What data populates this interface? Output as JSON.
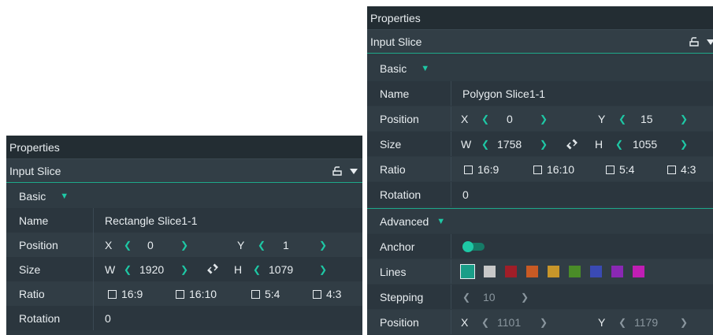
{
  "left_panel": {
    "title": "Properties",
    "subtitle": "Input Slice",
    "basic": {
      "label": "Basic"
    },
    "name": {
      "label": "Name",
      "value": "Rectangle Slice1-1"
    },
    "position": {
      "label": "Position",
      "x_label": "X",
      "x": "0",
      "y_label": "Y",
      "y": "1"
    },
    "size": {
      "label": "Size",
      "w_label": "W",
      "w": "1920",
      "h_label": "H",
      "h": "1079"
    },
    "ratio": {
      "label": "Ratio",
      "options": [
        "16:9",
        "16:10",
        "5:4",
        "4:3"
      ]
    },
    "rotation": {
      "label": "Rotation",
      "value": "0"
    }
  },
  "right_panel": {
    "title": "Properties",
    "subtitle": "Input Slice",
    "basic": {
      "label": "Basic"
    },
    "name": {
      "label": "Name",
      "value": "Polygon Slice1-1"
    },
    "position": {
      "label": "Position",
      "x_label": "X",
      "x": "0",
      "y_label": "Y",
      "y": "15"
    },
    "size": {
      "label": "Size",
      "w_label": "W",
      "w": "1758",
      "h_label": "H",
      "h": "1055"
    },
    "ratio": {
      "label": "Ratio",
      "options": [
        "16:9",
        "16:10",
        "5:4",
        "4:3"
      ]
    },
    "rotation": {
      "label": "Rotation",
      "value": "0"
    },
    "advanced": {
      "label": "Advanced"
    },
    "anchor": {
      "label": "Anchor",
      "enabled": true
    },
    "lines": {
      "label": "Lines",
      "colors": [
        "#1a9e88",
        "#c8c8c8",
        "#a01e28",
        "#c85a24",
        "#c8962a",
        "#4a8c28",
        "#3a4ab4",
        "#8a28b4",
        "#c01eb4"
      ]
    },
    "stepping": {
      "label": "Stepping",
      "value": "10"
    },
    "position2": {
      "label": "Position",
      "x_label": "X",
      "x": "1101",
      "y_label": "Y",
      "y": "1179"
    }
  },
  "icons": {
    "tab_icon": "pin-tab-icon",
    "dropdown": "triangle-down-icon",
    "link": "link-icon"
  },
  "colors": {
    "accent": "#1ec8a5",
    "panel_bg": "#2e3a42",
    "title_bg": "#232d33"
  }
}
